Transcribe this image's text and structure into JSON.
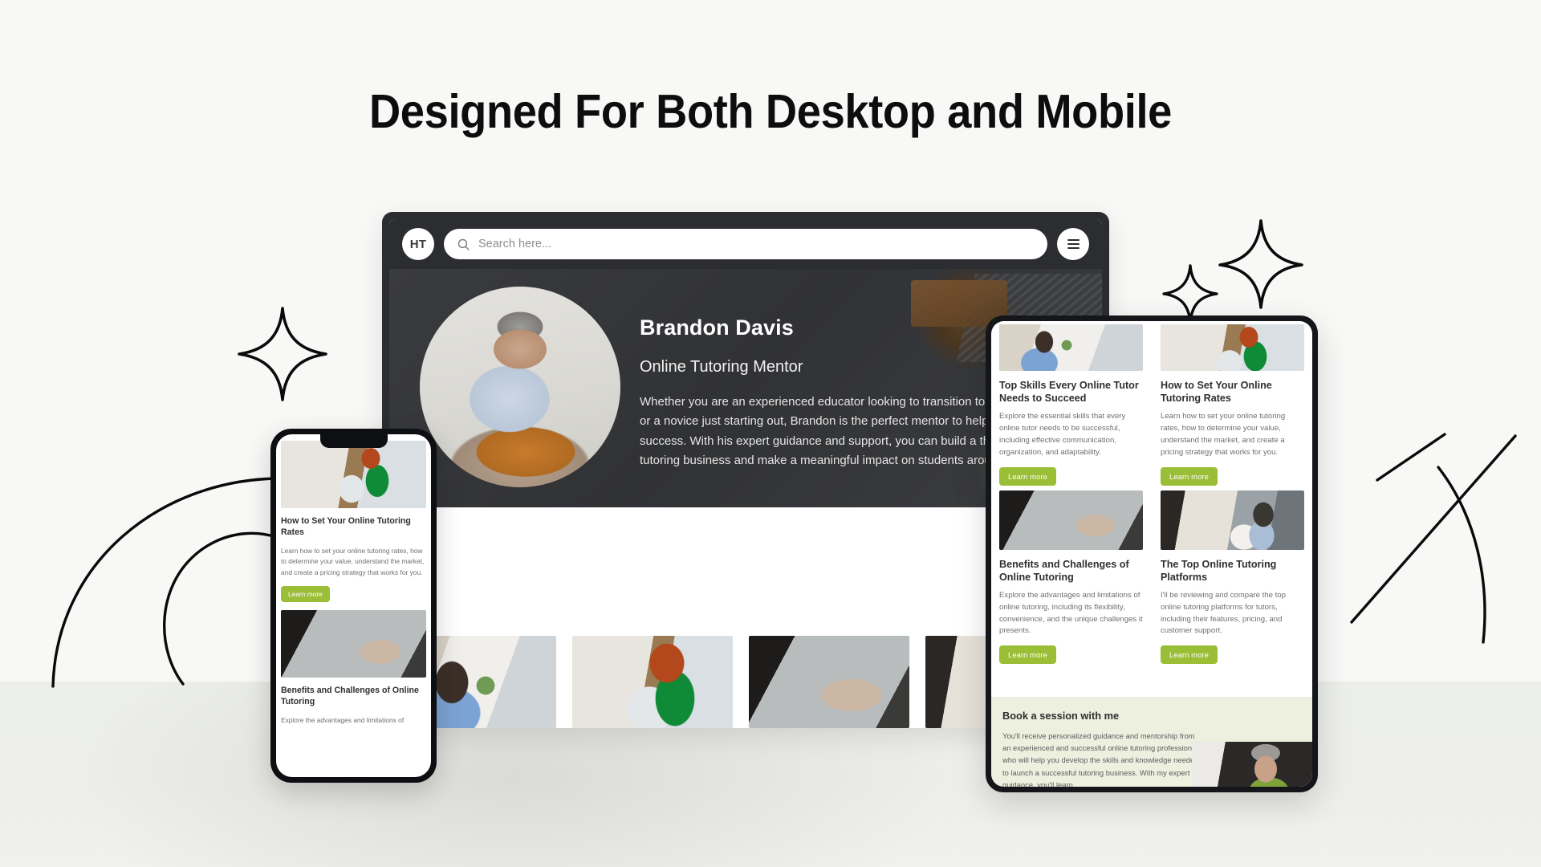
{
  "page": {
    "title": "Designed For Both Desktop and Mobile",
    "bg_top": "#f8f8f7",
    "bg_bottom": "#eceeea",
    "accent_green": "#9abe35",
    "dark": "#2b2d31"
  },
  "desktop": {
    "header": {
      "logo_text": "HT",
      "search_placeholder": "Search here...",
      "search_value": "",
      "search_icon": "search-icon",
      "menu_icon": "hamburger-menu-icon"
    },
    "hero": {
      "name": "Brandon Davis",
      "role": "Online Tutoring Mentor",
      "description": "Whether you are an experienced educator looking to transition to online tutoring or a novice just starting out, Brandon is the perfect mentor to help you achieve success. With his expert guidance and support, you can build a thriving online tutoring business and make a meaningful impact on students around the world.",
      "portrait_alt": "portrait-brandon-davis"
    },
    "gallery": [
      {
        "alt": "man-in-blue-shirt-at-laptop"
      },
      {
        "alt": "woman-with-green-scarf-writing"
      },
      {
        "alt": "hands-typing-on-laptop"
      },
      {
        "alt": "student-with-laptop-and-paper"
      }
    ]
  },
  "tablet": {
    "cards": [
      {
        "title": "Top Skills Every Online Tutor Needs to Succeed",
        "description": "Explore the essential skills that every online tutor needs to be successful, including effective communication, organization, and adaptability.",
        "button": "Learn more",
        "image_alt": "man-in-blue-shirt-at-laptop"
      },
      {
        "title": "How to Set Your Online Tutoring Rates",
        "description": "Learn how to set your online tutoring rates, how to determine your value, understand the market, and create a pricing strategy that works for you.",
        "button": "Learn more",
        "image_alt": "woman-with-green-scarf-writing"
      },
      {
        "title": "Benefits and Challenges of Online Tutoring",
        "description": "Explore the advantages and limitations of online tutoring, including its flexibility, convenience, and the unique challenges it presents.",
        "button": "Learn more",
        "image_alt": "hands-typing-on-laptop"
      },
      {
        "title": "The Top Online Tutoring Platforms",
        "description": "I'll be reviewing and compare the top online tutoring platforms for tutors, including their features, pricing, and customer support.",
        "button": "Learn more",
        "image_alt": "student-with-headphones-and-laptop"
      }
    ],
    "book": {
      "title": "Book a session with me",
      "description": "You'll receive personalized guidance and mentorship from an experienced and successful online tutoring professional who will help you develop the skills and knowledge needed to launch a successful tutoring business. With my expert guidance, you'll learn",
      "image_alt": "portrait-brandon-davis"
    }
  },
  "phone": {
    "cards": [
      {
        "title": "How to Set Your Online Tutoring Rates",
        "description": "Learn how to set your online tutoring rates, how to determine your value, understand the market, and create a pricing strategy that works for you.",
        "button": "Learn more",
        "image_alt": "woman-with-green-scarf-writing"
      },
      {
        "title": "Benefits and Challenges of Online Tutoring",
        "description": "Explore the advantages and limitations of",
        "image_alt": "hands-typing-on-laptop"
      }
    ]
  },
  "decorations": {
    "sparkle_large": "sparkle-icon",
    "sparkle_small": "sparkle-icon",
    "arcs": "decorative-arcs",
    "lines": "decorative-diagonal-lines"
  }
}
